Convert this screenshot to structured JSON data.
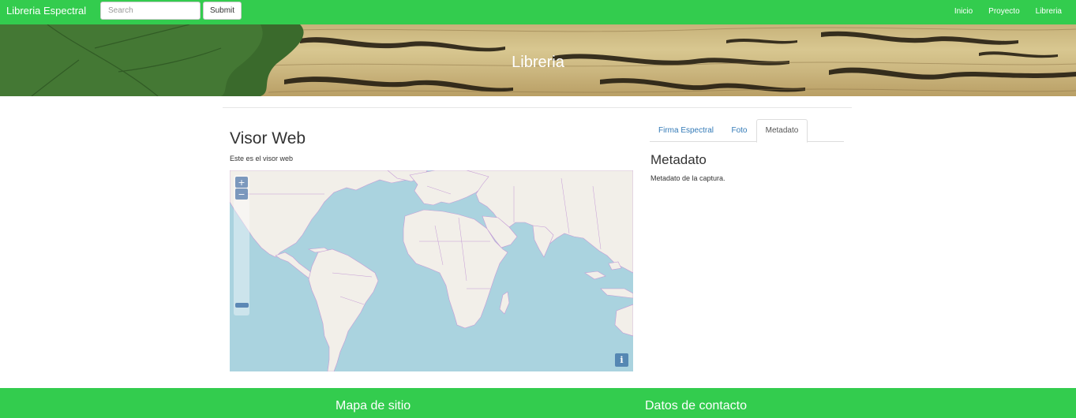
{
  "navbar": {
    "brand": "Libreria Espectral",
    "search_placeholder": "Search",
    "submit_label": "Submit",
    "links": [
      "Inicio",
      "Proyecto",
      "Libreria"
    ],
    "color": "#33cc4e"
  },
  "banner": {
    "title": "Libreria"
  },
  "viewer": {
    "title": "Visor Web",
    "description": "Este es el visor web",
    "zoom_in_label": "+",
    "zoom_out_label": "−",
    "info_label": "i"
  },
  "tabs": {
    "items": [
      "Firma Espectral",
      "Foto",
      "Metadato"
    ],
    "active": "Metadato"
  },
  "metadata": {
    "title": "Metadato",
    "description": "Metadato de la captura."
  },
  "footer": {
    "sitemap": "Mapa de sitio",
    "contact": "Datos de contacto"
  },
  "icons": {
    "zoom_in": "plus-icon",
    "zoom_out": "minus-icon",
    "info": "info-icon"
  }
}
